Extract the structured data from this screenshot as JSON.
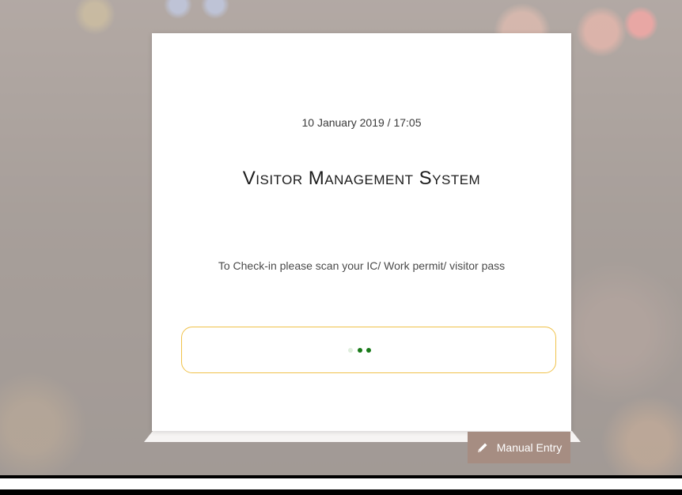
{
  "kiosk": {
    "datetime": "10 January 2019 / 17:05",
    "title": "Visitor Management System",
    "instruction": "To Check-in please scan your IC/ Work permit/ visitor pass",
    "scan_status": "waiting",
    "manual_entry_label": "Manual Entry",
    "manual_entry_icon": "pencil-icon"
  },
  "colors": {
    "accent_border": "#f0c24a",
    "loader_dot": "#1a7a1a",
    "button_bg": "#a68d82"
  }
}
